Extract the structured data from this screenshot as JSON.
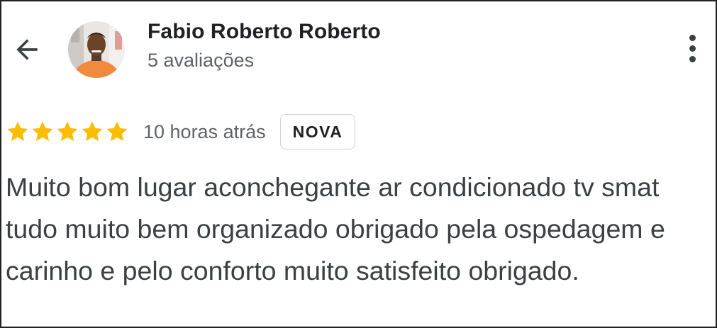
{
  "header": {
    "back_icon": "arrow-back-icon",
    "avatar_icon": "user-avatar",
    "reviewer_name": "Fabio Roberto Roberto",
    "review_count": "5 avaliações",
    "menu_icon": "more-vert-icon"
  },
  "rating": {
    "stars": 5,
    "max_stars": 5,
    "star_color": "#fbbc04",
    "time_ago": "10 horas atrás",
    "badge": "NOVA"
  },
  "review": {
    "text": "Muito bom lugar aconchegante ar condicionado tv smat\ntudo muito bem organizado obrigado pela ospedagem e\ncarinho e pelo conforto muito satisfeito obrigado."
  }
}
